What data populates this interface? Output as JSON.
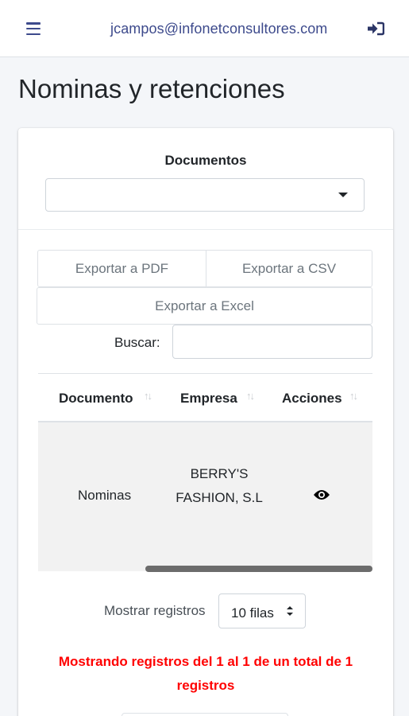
{
  "header": {
    "menu_icon": "hamburger-icon",
    "user_email": "jcampos@infonetconsultores.com",
    "logout_icon": "logout-icon"
  },
  "page": {
    "title": "Nominas y retenciones"
  },
  "documents_filter": {
    "label": "Documentos",
    "selected_value": ""
  },
  "export_buttons": {
    "pdf": "Exportar a PDF",
    "csv": "Exportar a CSV",
    "excel": "Exportar a Excel"
  },
  "search": {
    "label": "Buscar:",
    "value": ""
  },
  "table": {
    "columns": [
      "Documento",
      "Empresa",
      "Acciones"
    ],
    "rows": [
      {
        "documento": "Nominas",
        "empresa": "BERRY'S FASHION, S.L",
        "accion_icon": "eye-icon"
      }
    ]
  },
  "pagination": {
    "rows_label": "Mostrar registros",
    "rows_selected": "10 filas",
    "info": "Mostrando registros del 1 al 1 de un total de 1 registros"
  },
  "colors": {
    "accent": "#3d4a8c",
    "info_text": "#ff0000",
    "row_stripe": "#f2f2f2"
  }
}
